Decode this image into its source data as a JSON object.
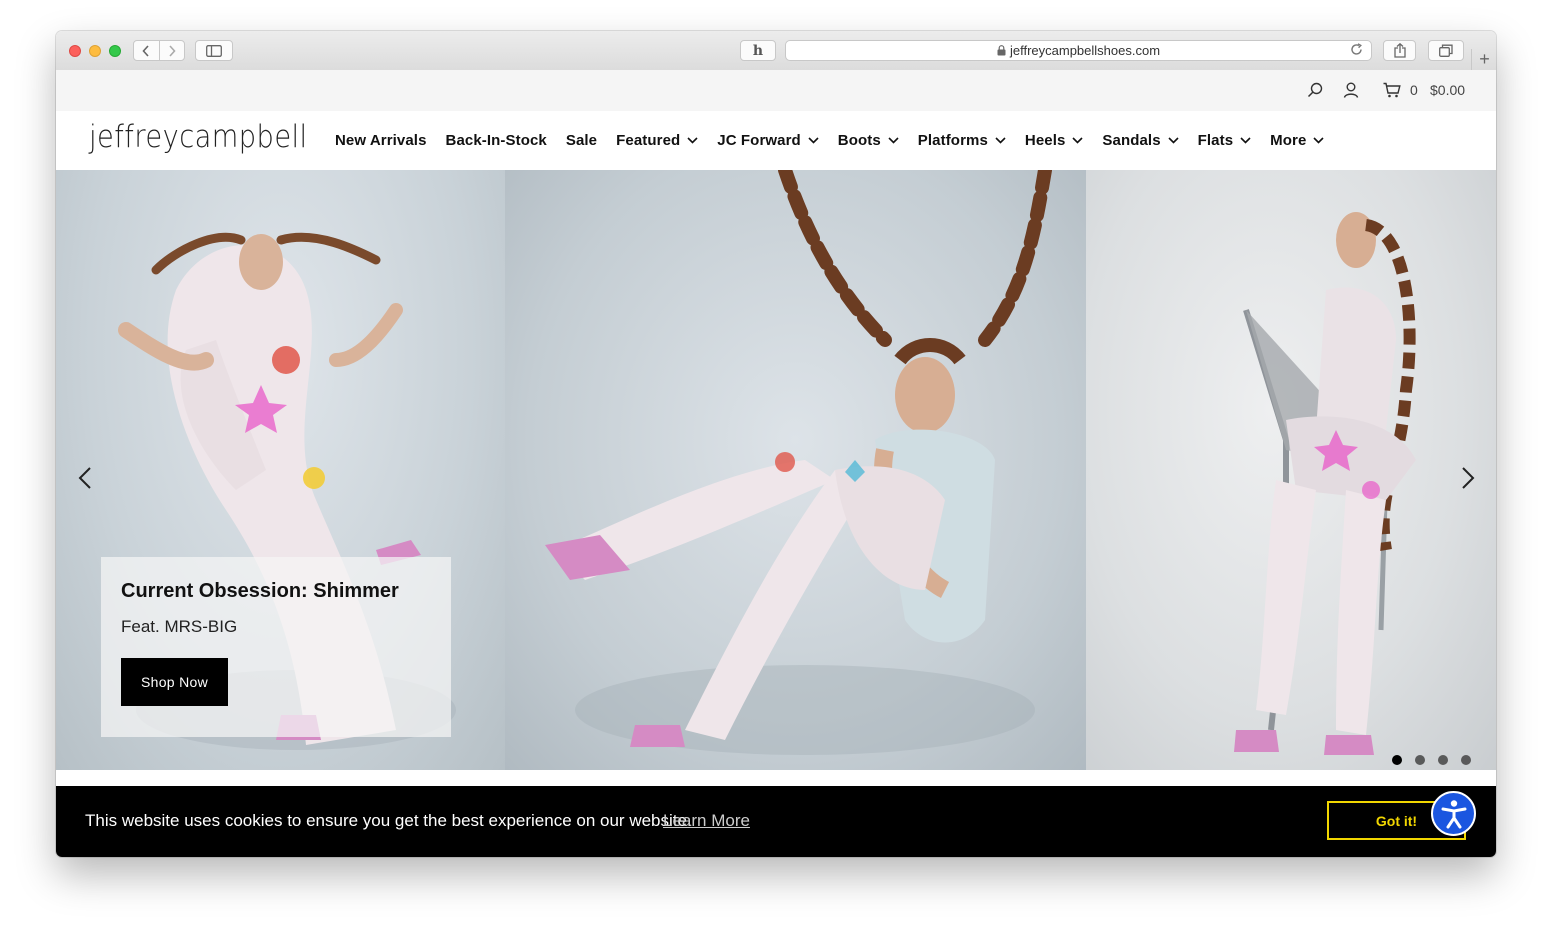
{
  "browser": {
    "url": "jeffreycampbellshoes.com",
    "h_extension": "h"
  },
  "utility": {
    "cart_count": "0",
    "cart_total": "$0.00"
  },
  "header": {
    "logo": "jeffreycampbell",
    "nav": [
      {
        "label": "New Arrivals",
        "dropdown": false
      },
      {
        "label": "Back-In-Stock",
        "dropdown": false
      },
      {
        "label": "Sale",
        "dropdown": false
      },
      {
        "label": "Featured",
        "dropdown": true
      },
      {
        "label": "JC Forward",
        "dropdown": true
      },
      {
        "label": "Boots",
        "dropdown": true
      },
      {
        "label": "Platforms",
        "dropdown": true
      },
      {
        "label": "Heels",
        "dropdown": true
      },
      {
        "label": "Sandals",
        "dropdown": true
      },
      {
        "label": "Flats",
        "dropdown": true
      },
      {
        "label": "More",
        "dropdown": true
      }
    ]
  },
  "hero": {
    "title": "Current Obsession: Shimmer",
    "subtitle": "Feat. MRS-BIG",
    "cta": "Shop Now",
    "slide_count": 4,
    "active_slide": 1
  },
  "cookie": {
    "message": "This website uses cookies to ensure you get the best experience on our website.",
    "link": "Learn More",
    "button": "Got it!"
  },
  "colors": {
    "cookie_button": "#f1d600",
    "accessibility_button": "#1b56e0"
  }
}
